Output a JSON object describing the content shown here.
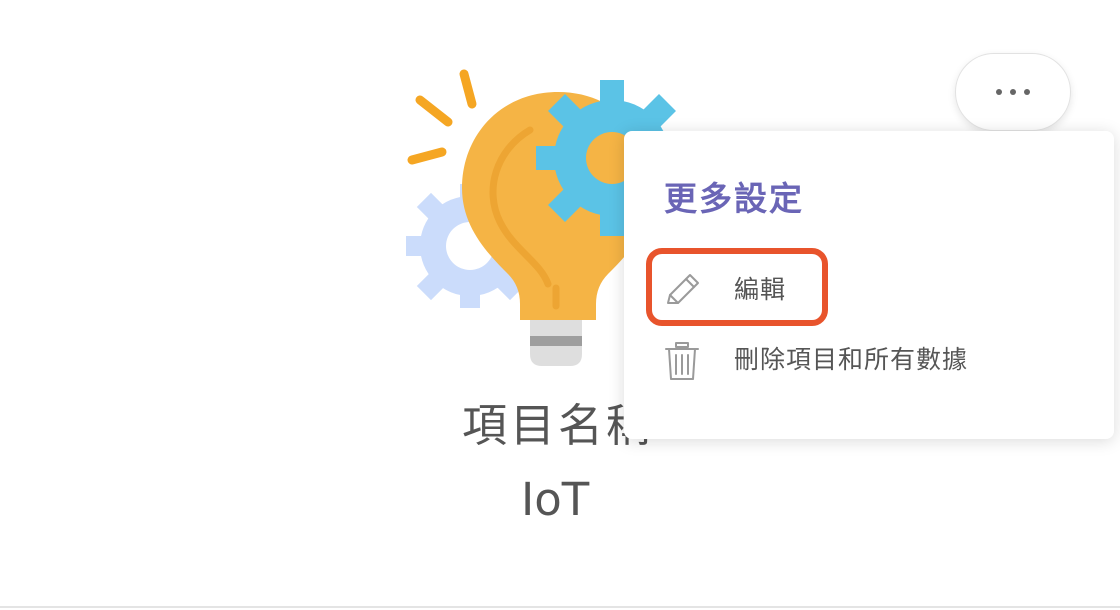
{
  "project": {
    "label": "項目名稱",
    "name": "IoT"
  },
  "more_button": {
    "icon": "more-dots-icon"
  },
  "menu": {
    "title": "更多設定",
    "items": [
      {
        "label": "編輯",
        "icon": "pencil-icon"
      },
      {
        "label": "刪除項目和所有數據",
        "icon": "trash-icon"
      }
    ]
  },
  "colors": {
    "menu_title": "#6a65b6",
    "highlight": "#e8542c",
    "bulb": "#f5b445",
    "gear_blue": "#5bc3e6",
    "gear_light": "#cbdcfb",
    "rays": "#f5a623"
  }
}
